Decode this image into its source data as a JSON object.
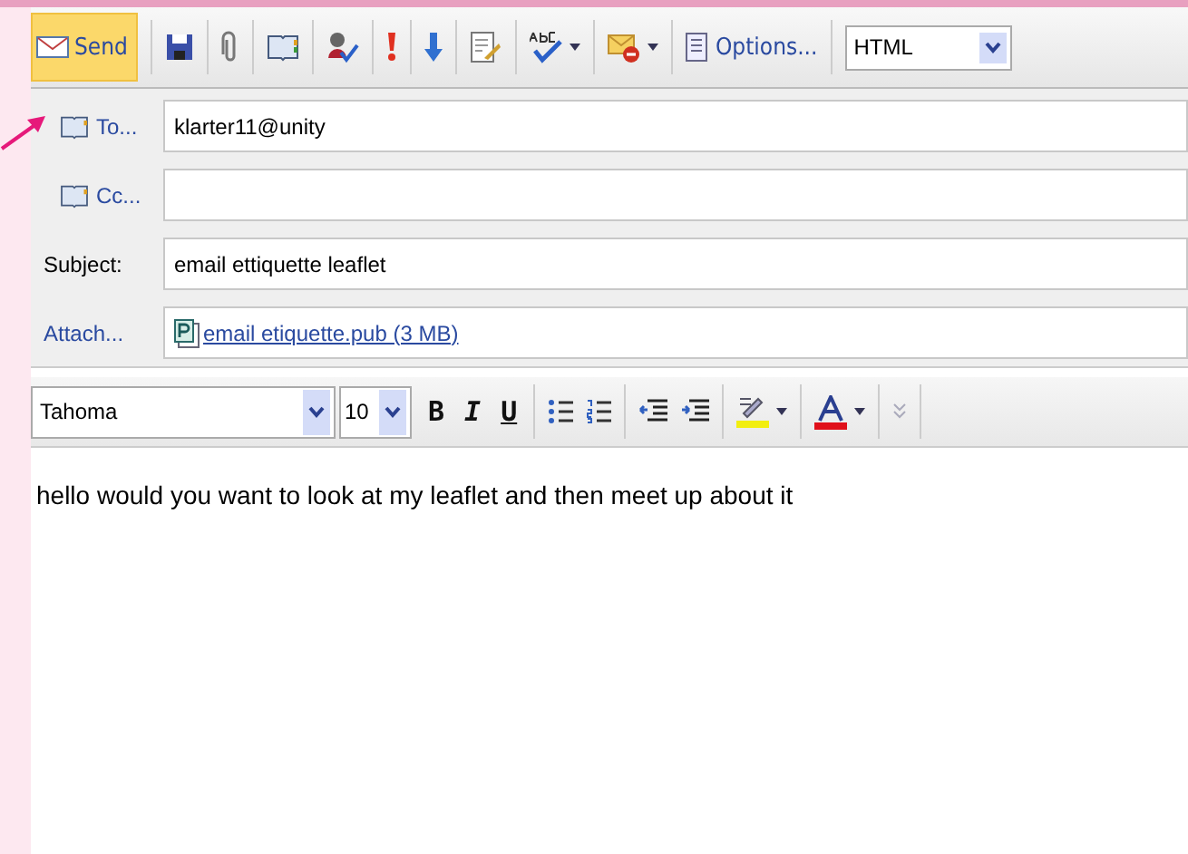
{
  "toolbar": {
    "send": "Send",
    "options": "Options...",
    "format": "HTML"
  },
  "fields": [
    {
      "kind": "address",
      "label": "To...",
      "value": "klarter11@unity"
    },
    {
      "kind": "address",
      "label": "Cc..."
    },
    {
      "kind": "text",
      "label": "Subject:",
      "value": "email ettiquette leaflet"
    },
    {
      "kind": "attachment",
      "label": "Attach...",
      "file": "email etiquette.pub (3 MB)"
    }
  ],
  "format_bar": {
    "font": "Tahoma",
    "size": "10",
    "bold": "B",
    "italic": "I",
    "underline": "U"
  },
  "body": "hello would you want to look at my leaflet and then meet up about it"
}
